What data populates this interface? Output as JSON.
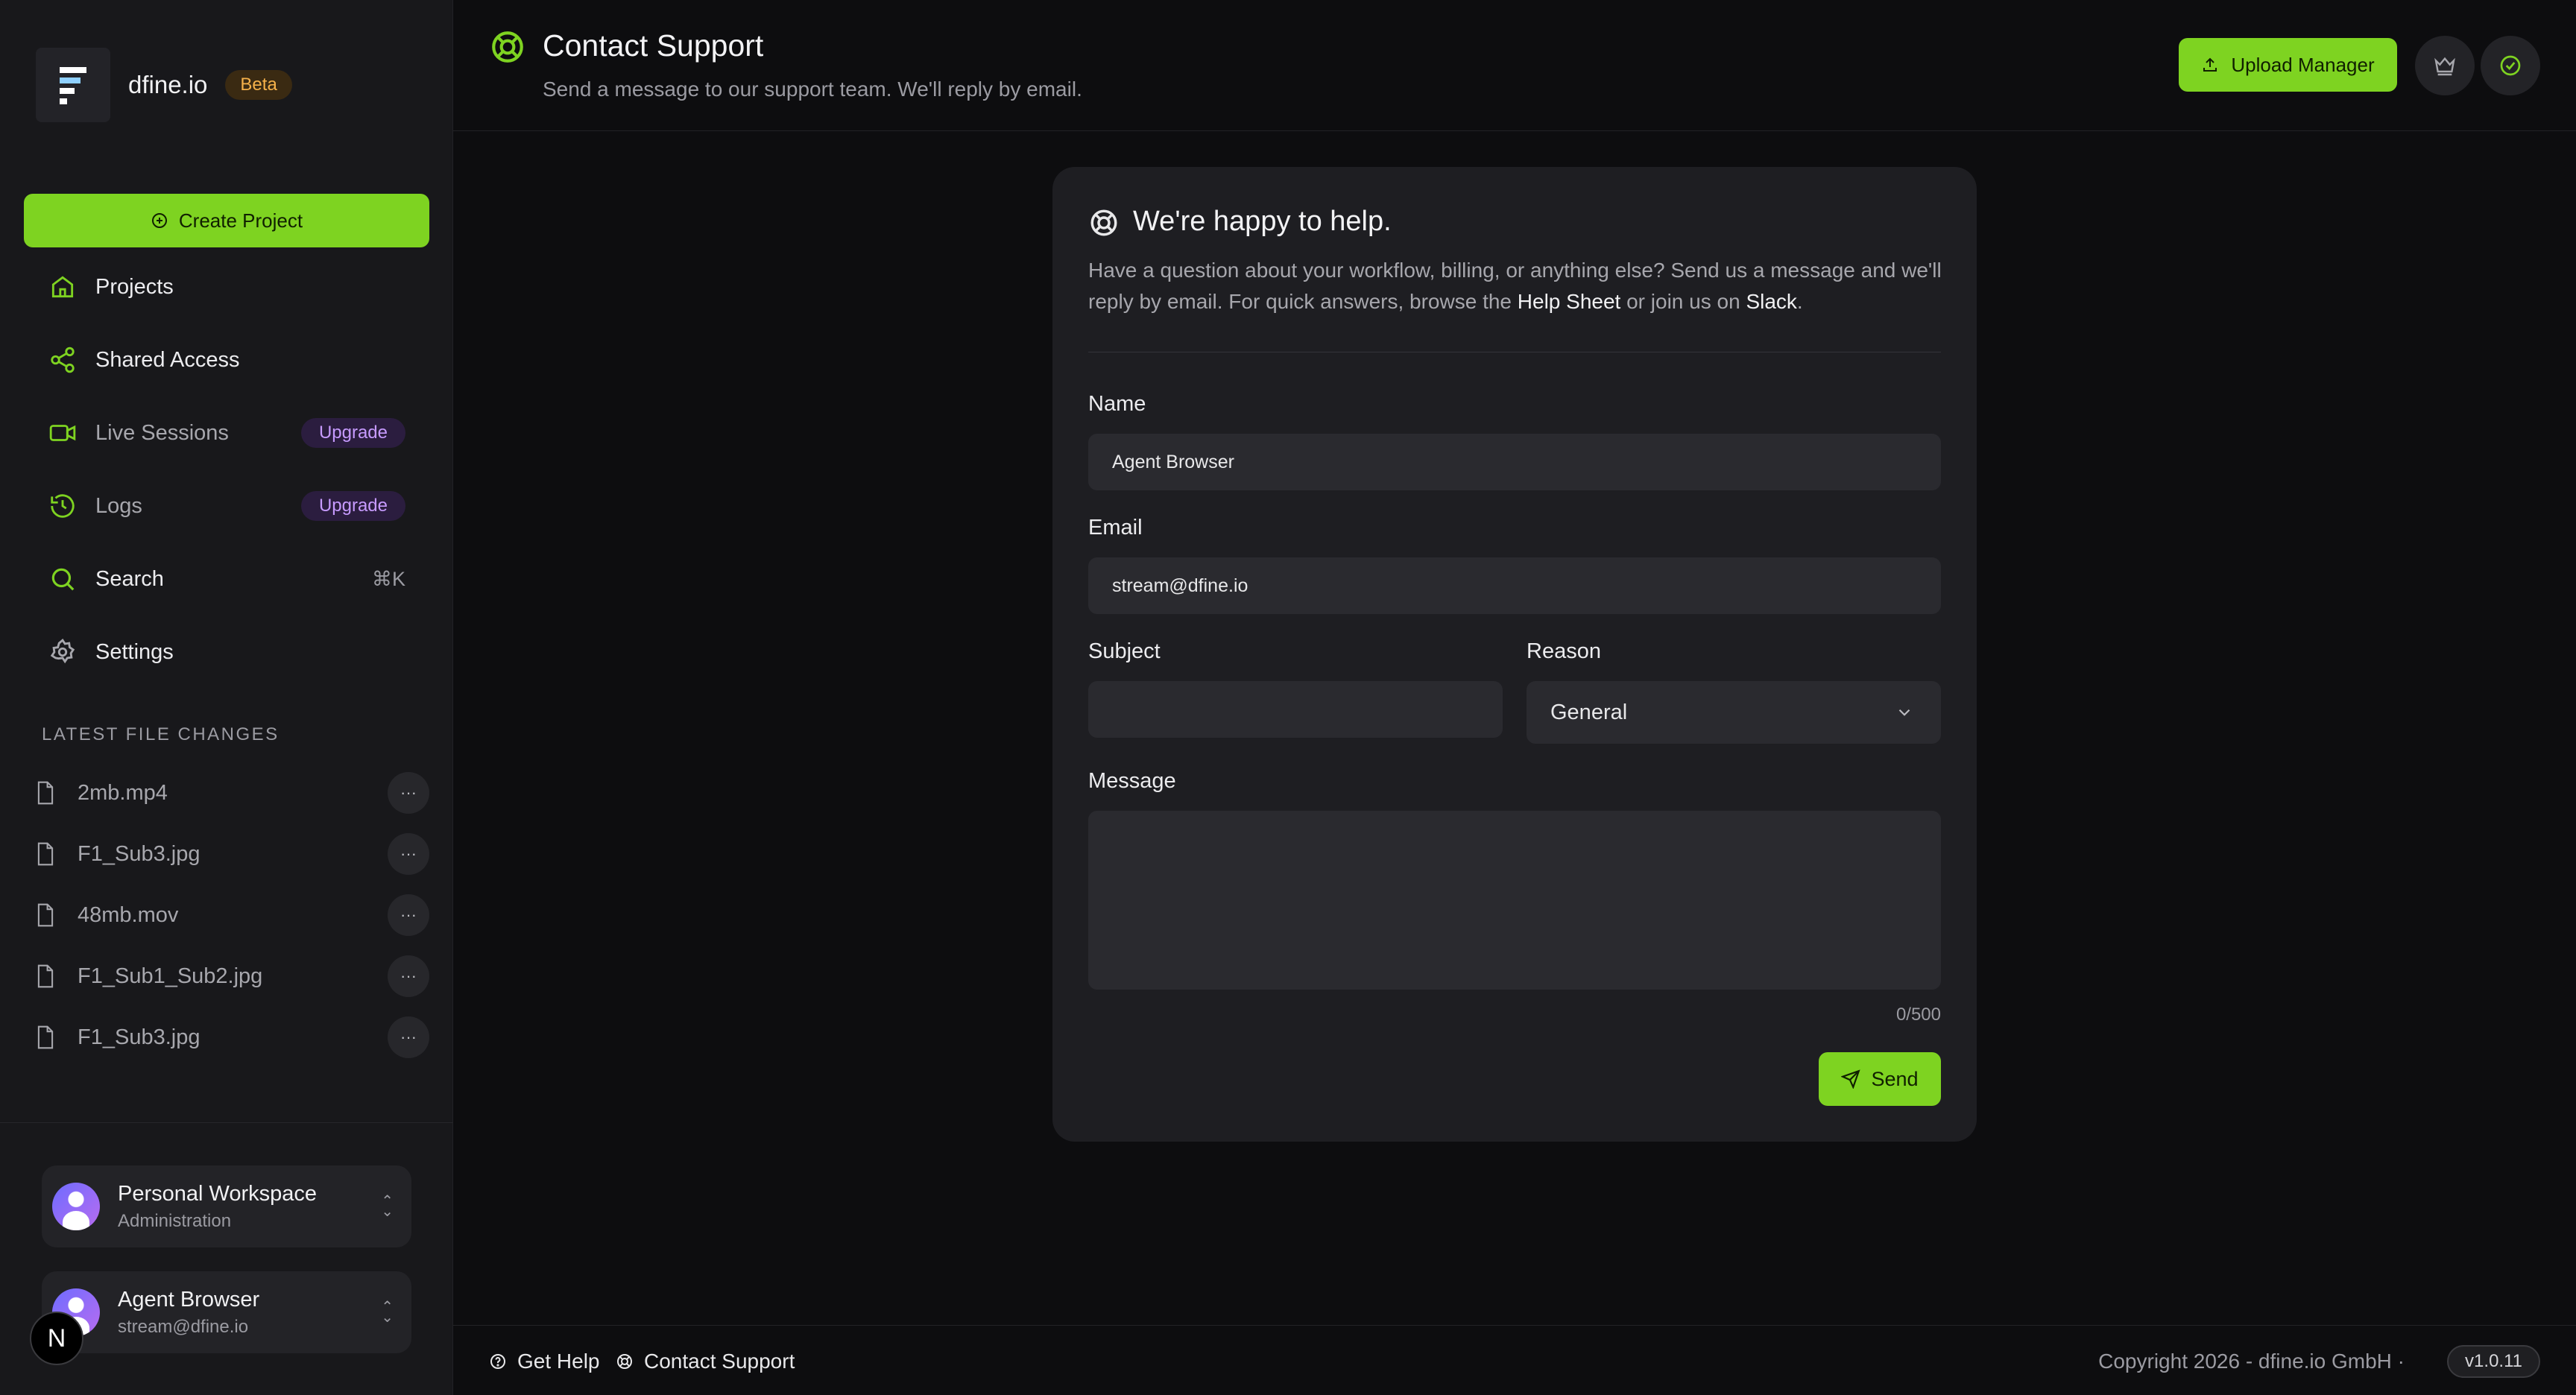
{
  "brand": {
    "name": "dfine.io",
    "badge": "Beta"
  },
  "sidebar": {
    "create_label": "Create Project",
    "nav": [
      {
        "label": "Projects"
      },
      {
        "label": "Shared Access"
      },
      {
        "label": "Live Sessions",
        "badge": "Upgrade"
      },
      {
        "label": "Logs",
        "badge": "Upgrade"
      },
      {
        "label": "Search",
        "shortcut": "⌘K"
      },
      {
        "label": "Settings"
      }
    ],
    "files_title": "LATEST FILE CHANGES",
    "files": [
      "2mb.mp4",
      "F1_Sub3.jpg",
      "48mb.mov",
      "F1_Sub1_Sub2.jpg",
      "F1_Sub3.jpg"
    ],
    "workspace": {
      "title": "Personal Workspace",
      "subtitle": "Administration"
    },
    "user": {
      "name": "Agent Browser",
      "email": "stream@dfine.io"
    },
    "n_badge": "N"
  },
  "header": {
    "title": "Contact Support",
    "subtitle": "Send a message to our support team. We'll reply by email.",
    "upload_label": "Upload Manager"
  },
  "card": {
    "title": "We're happy to help.",
    "desc_1": "Have a question about your workflow, billing, or anything else? Send us a message and we'll reply by email. For quick answers, browse the ",
    "help_link": "Help Sheet",
    "desc_2": " or join us on ",
    "slack_link": "Slack",
    "desc_3": ".",
    "name_label": "Name",
    "name_value": "Agent Browser",
    "email_label": "Email",
    "email_value": "stream@dfine.io",
    "subject_label": "Subject",
    "subject_value": "",
    "reason_label": "Reason",
    "reason_value": "General",
    "message_label": "Message",
    "message_value": "",
    "counter": "0/500",
    "send_label": "Send"
  },
  "footer": {
    "get_help": "Get Help",
    "contact": "Contact Support",
    "copyright": "Copyright 2026 - dfine.io GmbH  ·",
    "version": "v1.0.11"
  },
  "colors": {
    "accent": "#7ed321",
    "background": "#0d0d0f",
    "sidebar": "#18181b",
    "card": "#1e1e22"
  }
}
